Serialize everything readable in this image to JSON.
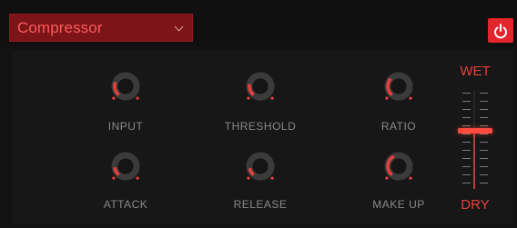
{
  "header": {
    "preset": {
      "label": "Compressor",
      "icon": "chevron-down-icon"
    },
    "power": {
      "icon": "power-icon",
      "active": true
    }
  },
  "knobs": [
    {
      "id": "input",
      "label": "INPUT",
      "value": 0.22
    },
    {
      "id": "threshold",
      "label": "THRESHOLD",
      "value": 0.18
    },
    {
      "id": "ratio",
      "label": "RATIO",
      "value": 0.3
    },
    {
      "id": "attack",
      "label": "ATTACK",
      "value": 0.12
    },
    {
      "id": "release",
      "label": "RELEASE",
      "value": 0.1
    },
    {
      "id": "makeup",
      "label": "MAKE UP",
      "value": 0.38
    }
  ],
  "mix": {
    "wet_label": "WET",
    "dry_label": "DRY",
    "value": 0.58
  },
  "colors": {
    "accent": "#e8403e",
    "select_bg": "#7c1418",
    "power_bg": "#e2262b",
    "panel_bg": "#171717",
    "label_gray": "#8a8a8a"
  }
}
